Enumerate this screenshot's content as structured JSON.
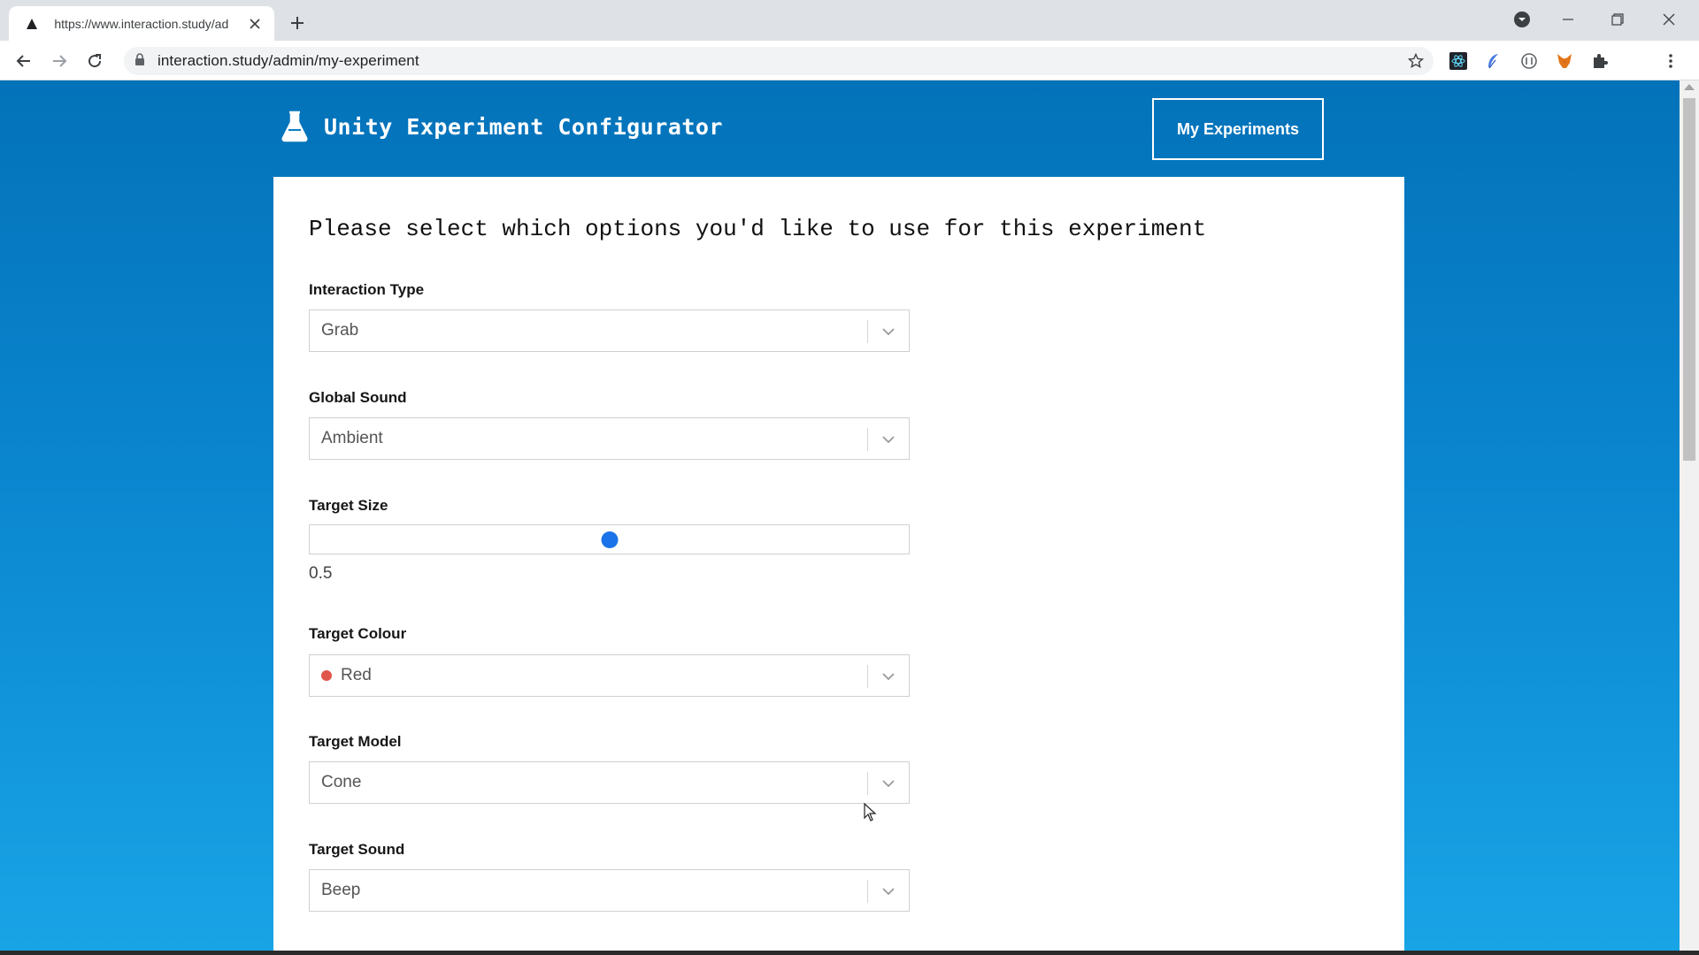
{
  "browser": {
    "tab_title": "https://www.interaction.study/ad",
    "url": "interaction.study/admin/my-experiment"
  },
  "page": {
    "app_title": "Unity Experiment Configurator",
    "nav_button": "My Experiments",
    "heading": "Please select which options you'd like to use for this experiment",
    "fields": {
      "interaction_type": {
        "label": "Interaction Type",
        "value": "Grab"
      },
      "global_sound": {
        "label": "Global Sound",
        "value": "Ambient"
      },
      "target_size": {
        "label": "Target Size",
        "value": "0.5",
        "slider_fraction": 0.5
      },
      "target_colour": {
        "label": "Target Colour",
        "value": "Red",
        "swatch_color": "#e0564a"
      },
      "target_model": {
        "label": "Target Model",
        "value": "Cone"
      },
      "target_sound": {
        "label": "Target Sound",
        "value": "Beep"
      }
    }
  },
  "colors": {
    "brand_blue": "#0372b9",
    "slider_accent": "#1a73e8"
  }
}
